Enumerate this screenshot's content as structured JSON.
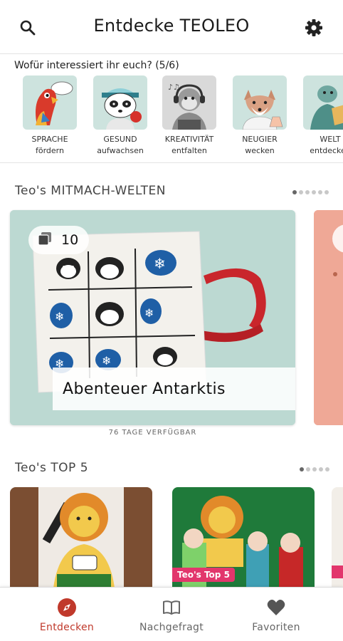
{
  "header": {
    "title": "Entdecke TEOLEO",
    "search_icon": "search-icon",
    "settings_icon": "gear-icon"
  },
  "interests": {
    "title": "Wofür interessiert ihr euch? (5/6)",
    "items": [
      {
        "line1": "SPRACHE",
        "line2": "fördern",
        "icon": "parrot-speaking-image"
      },
      {
        "line1": "GESUND",
        "line2": "aufwachsen",
        "icon": "panda-apple-image"
      },
      {
        "line1": "KREATIVITÄT",
        "line2": "entfalten",
        "icon": "monkey-headphones-image"
      },
      {
        "line1": "NEUGIER",
        "line2": "wecken",
        "icon": "fox-science-image"
      },
      {
        "line1": "WELT",
        "line2": "entdecken",
        "icon": "turtle-explorer-image"
      }
    ]
  },
  "worlds": {
    "title": "Teo's MITMACH-WELTEN",
    "page_count": 6,
    "active_page": 1,
    "card": {
      "count": "10",
      "caption": "Abenteuer Antarktis",
      "availability": "76 TAGE VERFÜGBAR"
    }
  },
  "top5": {
    "title": "Teo's TOP 5",
    "page_count": 5,
    "active_page": 1,
    "badge": "Teo's Top 5"
  },
  "nav": {
    "items": [
      {
        "label": "Entdecken",
        "icon": "compass-icon",
        "active": true
      },
      {
        "label": "Nachgefragt",
        "icon": "book-icon",
        "active": false
      },
      {
        "label": "Favoriten",
        "icon": "heart-icon",
        "active": false
      }
    ]
  },
  "colors": {
    "accent": "#c0392b",
    "badge": "#e2366c",
    "card_bg": "#bcd9d2",
    "peek_card_bg": "#efa896"
  }
}
